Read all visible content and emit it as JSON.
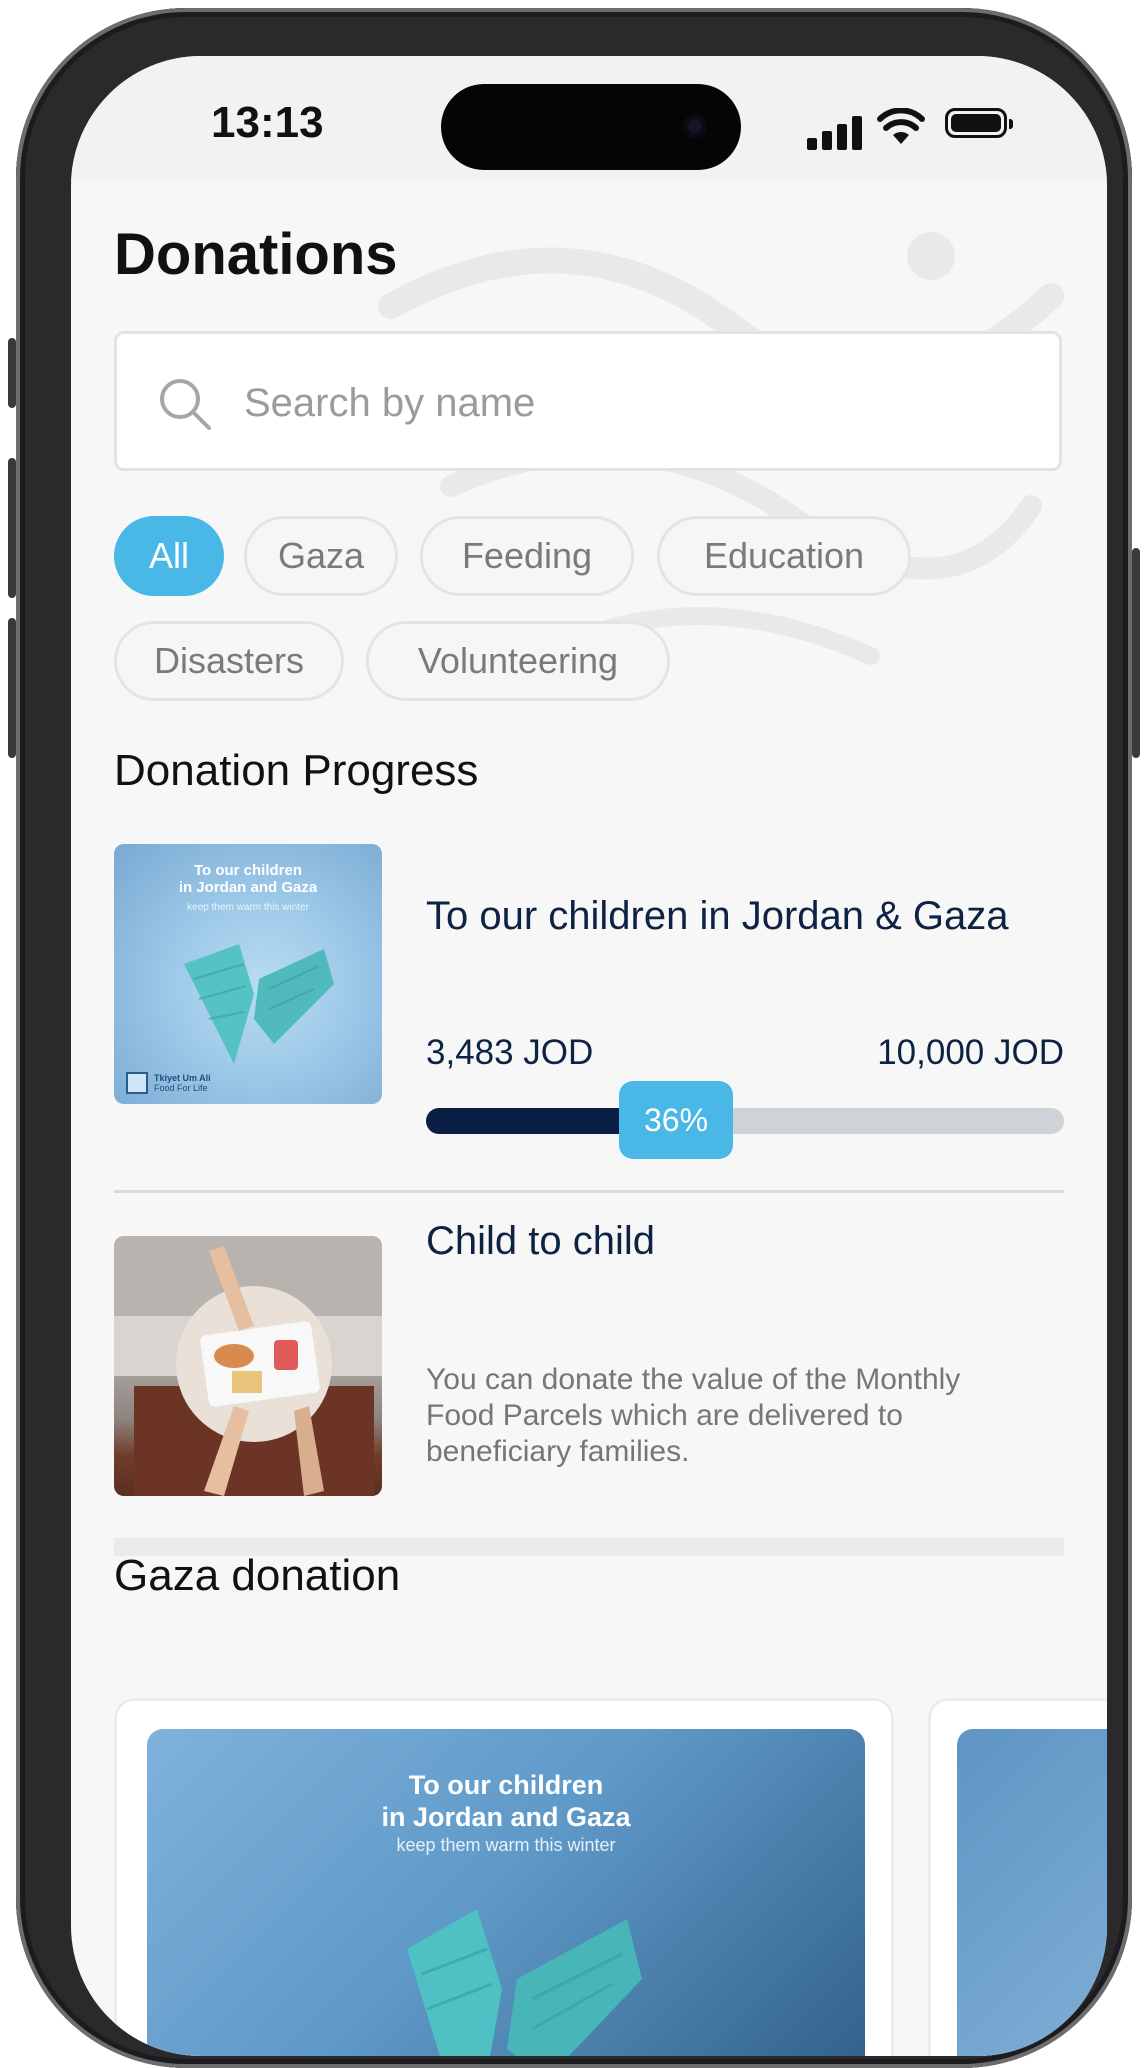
{
  "status_bar": {
    "time": "13:13"
  },
  "page": {
    "title": "Donations"
  },
  "search": {
    "placeholder": "Search by name",
    "value": ""
  },
  "filters": [
    {
      "label": "All",
      "active": true
    },
    {
      "label": "Gaza",
      "active": false
    },
    {
      "label": "Feeding",
      "active": false
    },
    {
      "label": "Education",
      "active": false
    },
    {
      "label": "Disasters",
      "active": false
    },
    {
      "label": "Volunteering",
      "active": false
    }
  ],
  "progress_section": {
    "title": "Donation Progress",
    "items": [
      {
        "title": "To our children in Jordan & Gaza",
        "raised": "3,483 JOD",
        "goal": "10,000 JOD",
        "percent_label": "36%",
        "percent": 0.36,
        "image": {
          "headline_1": "To our children",
          "headline_2": "in Jordan and Gaza",
          "subline": "keep them warm this winter",
          "logo_name": "Tkiyet Um Ali",
          "logo_tagline": "Food For Life"
        }
      },
      {
        "title": "Child to child",
        "description": "You can donate the value of the Monthly Food Parcels which are delivered to beneficiary families."
      }
    ]
  },
  "gaza_section": {
    "title": "Gaza donation",
    "cards": [
      {
        "headline_1": "To our children",
        "headline_2": "in Jordan and Gaza",
        "subline": "keep them warm this winter"
      }
    ]
  },
  "colors": {
    "accent": "#4AB8E6",
    "navy": "#0B1F45",
    "chip_border": "#E4E4E6"
  }
}
